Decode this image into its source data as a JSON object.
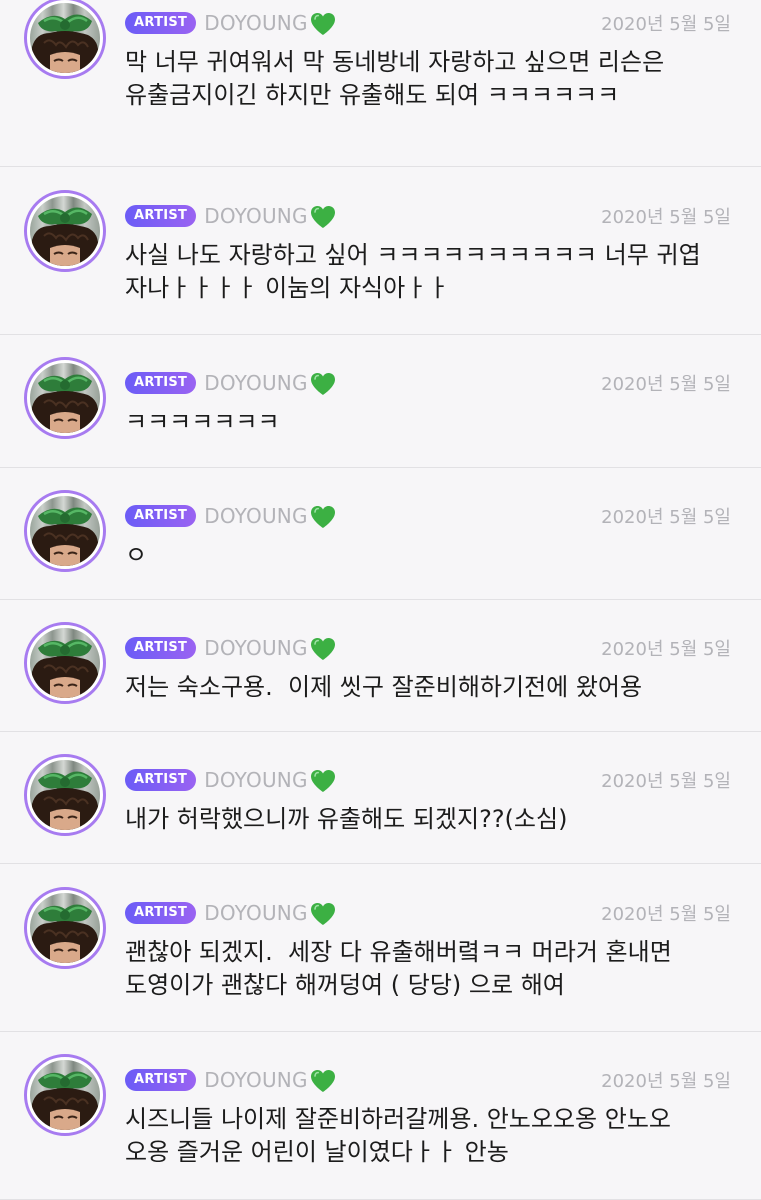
{
  "posts": [
    {
      "badge": "ARTIST",
      "username": "DOYOUNG",
      "heart_icon": "green-heart-icon",
      "date": "2020년 5월 5일",
      "message": "막 너무 귀여워서 막 동네방네 자랑하고 싶으면 리슨은\n유출금지이긴 하지만 유출해도 되여 ㅋㅋㅋㅋㅋㅋ"
    },
    {
      "badge": "ARTIST",
      "username": "DOYOUNG",
      "heart_icon": "green-heart-icon",
      "date": "2020년 5월 5일",
      "message": "사실 나도 자랑하고 싶어 ㅋㅋㅋㅋㅋㅋㅋㅋㅋㅋ 너무 귀엽\n자나ㅏㅏㅏㅏ 이눔의 자식아ㅏㅏ"
    },
    {
      "badge": "ARTIST",
      "username": "DOYOUNG",
      "heart_icon": "green-heart-icon",
      "date": "2020년 5월 5일",
      "message": "ㅋㅋㅋㅋㅋㅋㅋ"
    },
    {
      "badge": "ARTIST",
      "username": "DOYOUNG",
      "heart_icon": "green-heart-icon",
      "date": "2020년 5월 5일",
      "message": "ㅇ"
    },
    {
      "badge": "ARTIST",
      "username": "DOYOUNG",
      "heart_icon": "green-heart-icon",
      "date": "2020년 5월 5일",
      "message": "저는 숙소구용.  이제 씻구 잘준비해하기전에 왔어용"
    },
    {
      "badge": "ARTIST",
      "username": "DOYOUNG",
      "heart_icon": "green-heart-icon",
      "date": "2020년 5월 5일",
      "message": "내가 허락했으니까 유출해도 되겠지??(소심)"
    },
    {
      "badge": "ARTIST",
      "username": "DOYOUNG",
      "heart_icon": "green-heart-icon",
      "date": "2020년 5월 5일",
      "message": "괜찮아 되겠지.  세장 다 유출해버렼ㅋㅋ 머라거 혼내면\n도영이가 괜찮다 해꺼덩여 ( 당당) 으로 해여"
    },
    {
      "badge": "ARTIST",
      "username": "DOYOUNG",
      "heart_icon": "green-heart-icon",
      "date": "2020년 5월 5일",
      "message": "시즈니들 나이제 잘준비하러갈께용. 안노오오옹 안노오\n오옹 즐거운 어린이 날이였다ㅏㅏ 안농"
    }
  ],
  "colors": {
    "background": "#f7f6f8",
    "badge_start": "#6b5cf6",
    "badge_end": "#9a63f2",
    "avatar_ring": "#a77bf0",
    "muted_text": "#b3b3b8",
    "heart": "#3cb043",
    "divider": "#e2e1e4"
  }
}
